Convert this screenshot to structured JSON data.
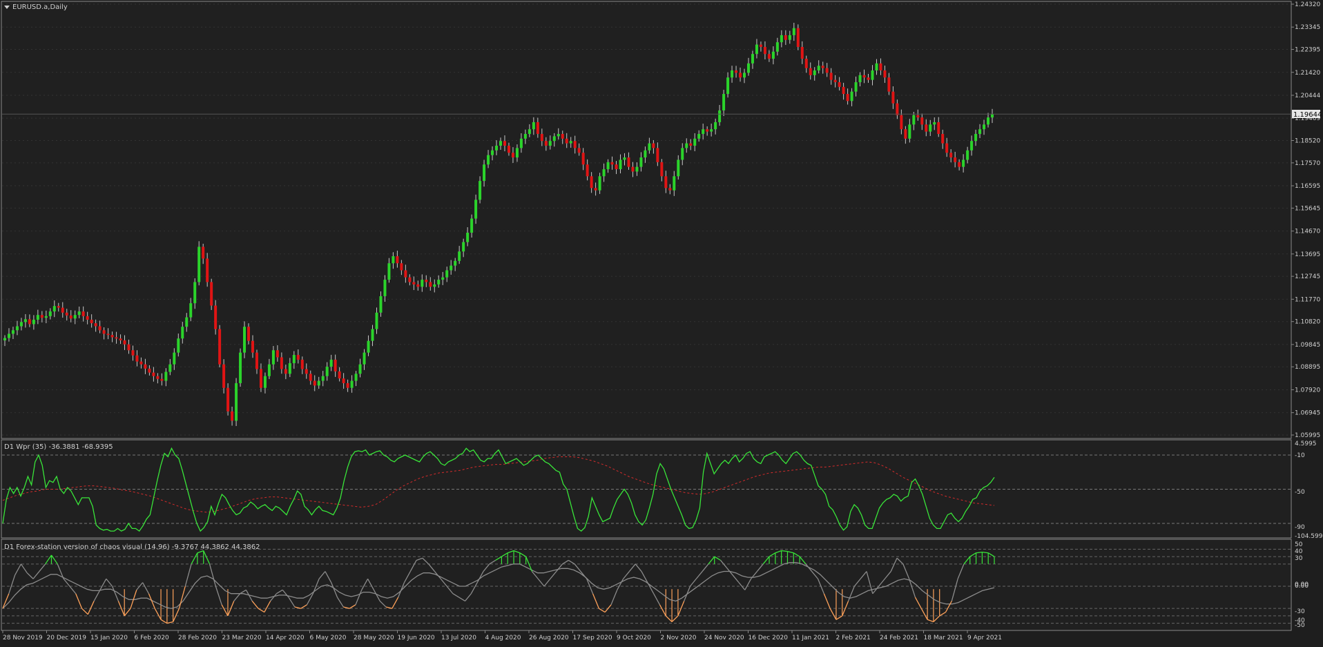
{
  "colors": {
    "background": "#1e1e1e",
    "chart_bg": "#202020",
    "grid": "#333333",
    "border": "#8a8a8a",
    "text": "#d0d0d0",
    "bull": "#2bd42b",
    "bear": "#e01414",
    "wick": "#c8c8c8",
    "wpr_line": "#39e639",
    "wpr_signal": "#d62b2b",
    "chaos_gray": "#8c8c8c",
    "chaos_green": "#39e639",
    "chaos_orange": "#ffa25a",
    "price_tag_bg": "#e8e8e8",
    "price_tag_text": "#000000"
  },
  "main": {
    "symbol_label": "EURUSD.a,Daily",
    "current_price": "1.19644"
  },
  "wpr": {
    "label": "D1 Wpr (35) -36.3881 -68.9395",
    "right_labels": [
      "4.5995",
      "-10",
      "-50",
      "-90",
      "-104.5996"
    ],
    "dashed_levels": [
      -10,
      -50,
      -90
    ]
  },
  "chaos": {
    "label": "D1 Forex-station version of chaos visual (14.96) -9.3767 44.3862 44.3862",
    "right_labels": [
      "50",
      "40",
      "30",
      "0.00",
      "0.00",
      "-30",
      "-40",
      "-50"
    ],
    "dashed_levels": [
      50,
      40,
      30,
      0,
      -30,
      -40,
      -50
    ]
  },
  "chart_data": [
    {
      "type": "candlestick",
      "title": "EURUSD.a,Daily",
      "ylim": [
        1.05995,
        1.2432
      ],
      "y_ticks": [
        "1.24320",
        "1.23345",
        "1.22395",
        "1.21420",
        "1.20444",
        "1.19469",
        "1.18520",
        "1.17570",
        "1.16595",
        "1.15645",
        "1.14670",
        "1.13695",
        "1.12745",
        "1.11770",
        "1.10820",
        "1.09845",
        "1.08895",
        "1.07920",
        "1.06945",
        "1.05995"
      ],
      "x_ticks": [
        "28 Nov 2019",
        "20 Dec 2019",
        "15 Jan 2020",
        "6 Feb 2020",
        "28 Feb 2020",
        "23 Mar 2020",
        "14 Apr 2020",
        "6 May 2020",
        "28 May 2020",
        "19 Jun 2020",
        "13 Jul 2020",
        "4 Aug 2020",
        "26 Aug 2020",
        "17 Sep 2020",
        "9 Oct 2020",
        "2 Nov 2020",
        "24 Nov 2020",
        "16 Dec 2020",
        "11 Jan 2021",
        "2 Feb 2021",
        "24 Feb 2021",
        "18 Mar 2021",
        "9 Apr 2021"
      ],
      "closes": [
        1.1012,
        1.103,
        1.1045,
        1.1062,
        1.108,
        1.1092,
        1.1071,
        1.109,
        1.111,
        1.1098,
        1.1105,
        1.1125,
        1.1148,
        1.1141,
        1.112,
        1.1108,
        1.1095,
        1.111,
        1.1125,
        1.1105,
        1.109,
        1.1075,
        1.1062,
        1.1045,
        1.103,
        1.1025,
        1.1015,
        1.101,
        1.1002,
        1.0985,
        1.096,
        1.0938,
        1.0912,
        1.09,
        1.0882,
        1.0865,
        1.085,
        1.0838,
        1.083,
        1.0868,
        1.09,
        1.095,
        1.101,
        1.106,
        1.11,
        1.116,
        1.125,
        1.14,
        1.135,
        1.125,
        1.115,
        1.105,
        1.09,
        1.08,
        1.07,
        1.066,
        1.082,
        1.095,
        1.106,
        1.1,
        1.095,
        1.088,
        1.08,
        1.085,
        1.09,
        1.096,
        1.093,
        1.088,
        1.086,
        1.0905,
        1.094,
        1.092,
        1.088,
        1.086,
        1.083,
        1.081,
        1.083,
        1.085,
        1.089,
        1.092,
        1.087,
        1.084,
        1.082,
        1.08,
        1.083,
        1.086,
        1.09,
        1.095,
        1.1,
        1.105,
        1.112,
        1.119,
        1.126,
        1.133,
        1.136,
        1.133,
        1.13,
        1.127,
        1.125,
        1.124,
        1.123,
        1.126,
        1.125,
        1.123,
        1.124,
        1.126,
        1.127,
        1.13,
        1.132,
        1.134,
        1.138,
        1.142,
        1.146,
        1.152,
        1.16,
        1.168,
        1.175,
        1.179,
        1.181,
        1.183,
        1.185,
        1.183,
        1.18,
        1.178,
        1.182,
        1.186,
        1.188,
        1.19,
        1.193,
        1.188,
        1.185,
        1.183,
        1.185,
        1.187,
        1.188,
        1.186,
        1.184,
        1.185,
        1.182,
        1.18,
        1.175,
        1.17,
        1.165,
        1.164,
        1.17,
        1.173,
        1.176,
        1.175,
        1.173,
        1.177,
        1.178,
        1.174,
        1.172,
        1.174,
        1.178,
        1.181,
        1.184,
        1.182,
        1.176,
        1.17,
        1.165,
        1.164,
        1.17,
        1.177,
        1.182,
        1.184,
        1.183,
        1.186,
        1.188,
        1.19,
        1.189,
        1.19,
        1.193,
        1.198,
        1.205,
        1.212,
        1.215,
        1.214,
        1.212,
        1.214,
        1.218,
        1.222,
        1.226,
        1.225,
        1.222,
        1.22,
        1.223,
        1.227,
        1.23,
        1.228,
        1.23,
        1.233,
        1.225,
        1.22,
        1.216,
        1.213,
        1.215,
        1.217,
        1.216,
        1.214,
        1.211,
        1.21,
        1.208,
        1.205,
        1.202,
        1.206,
        1.21,
        1.213,
        1.212,
        1.211,
        1.215,
        1.218,
        1.215,
        1.212,
        1.206,
        1.201,
        1.196,
        1.19,
        1.186,
        1.192,
        1.196,
        1.195,
        1.192,
        1.189,
        1.192,
        1.193,
        1.188,
        1.184,
        1.18,
        1.178,
        1.176,
        1.174,
        1.177,
        1.181,
        1.185,
        1.188,
        1.19,
        1.192,
        1.195,
        1.1964
      ],
      "current_price": 1.19644
    },
    {
      "type": "line",
      "title": "D1 Wpr (35) -36.3881 -68.9395",
      "ylim": [
        -104.5996,
        4.5995
      ],
      "series": [
        {
          "values": [
            -90,
            -62,
            -48,
            -55,
            -48,
            -58,
            -48,
            -35,
            -45,
            -18,
            -10,
            -22,
            -48,
            -40,
            -42,
            -35,
            -50,
            -55,
            -48,
            -52,
            -60,
            -68,
            -60,
            -60,
            -60,
            -70,
            -92,
            -96,
            -98,
            -97,
            -99,
            -99,
            -96,
            -99,
            -97,
            -90,
            -96,
            -96,
            -99,
            -93,
            -85,
            -80,
            -60,
            -40,
            -22,
            -8,
            -12,
            -2,
            -10,
            -14,
            -28,
            -44,
            -60,
            -76,
            -90,
            -99,
            -95,
            -88,
            -70,
            -80,
            -67,
            -56,
            -60,
            -68,
            -75,
            -80,
            -78,
            -72,
            -70,
            -65,
            -68,
            -73,
            -70,
            -68,
            -72,
            -75,
            -70,
            -72,
            -76,
            -80,
            -70,
            -62,
            -52,
            -56,
            -70,
            -74,
            -80,
            -74,
            -70,
            -75,
            -76,
            -78,
            -80,
            -72,
            -60,
            -40,
            -24,
            -12,
            -6,
            -5,
            -6,
            -4,
            -10,
            -8,
            -6,
            -5,
            -10,
            -12,
            -16,
            -18,
            -14,
            -12,
            -10,
            -12,
            -14,
            -16,
            -18,
            -12,
            -8,
            -6,
            -10,
            -14,
            -20,
            -22,
            -18,
            -16,
            -14,
            -10,
            -8,
            -2,
            -6,
            -4,
            -10,
            -16,
            -18,
            -14,
            -14,
            -8,
            -4,
            -12,
            -20,
            -18,
            -16,
            -14,
            -18,
            -22,
            -20,
            -16,
            -12,
            -10,
            -14,
            -18,
            -20,
            -24,
            -28,
            -30,
            -44,
            -50,
            -66,
            -82,
            -96,
            -99,
            -95,
            -82,
            -60,
            -70,
            -80,
            -88,
            -86,
            -84,
            -72,
            -62,
            -56,
            -50,
            -56,
            -66,
            -80,
            -88,
            -92,
            -86,
            -72,
            -56,
            -32,
            -20,
            -26,
            -38,
            -50,
            -60,
            -70,
            -80,
            -92,
            -96,
            -95,
            -86,
            -72,
            -30,
            -8,
            -20,
            -32,
            -26,
            -20,
            -16,
            -20,
            -14,
            -10,
            -18,
            -14,
            -8,
            -6,
            -14,
            -18,
            -20,
            -12,
            -10,
            -8,
            -6,
            -10,
            -16,
            -20,
            -14,
            -8,
            -6,
            -10,
            -16,
            -20,
            -22,
            -34,
            -46,
            -50,
            -56,
            -70,
            -74,
            -82,
            -92,
            -98,
            -94,
            -76,
            -68,
            -72,
            -80,
            -92,
            -96,
            -96,
            -84,
            -72,
            -66,
            -62,
            -60,
            -56,
            -58,
            -64,
            -60,
            -58,
            -42,
            -38,
            -46,
            -56,
            -70,
            -84,
            -92,
            -96,
            -96,
            -88,
            -80,
            -78,
            -84,
            -88,
            -84,
            -76,
            -70,
            -62,
            -60,
            -52,
            -48,
            -46,
            -42,
            -36
          ]
        },
        {
          "values": [
            -63,
            -60,
            -57,
            -55,
            -53,
            -52,
            -50,
            -50,
            -50,
            -49,
            -48,
            -47,
            -46,
            -46,
            -47,
            -48,
            -49,
            -51,
            -52,
            -54,
            -56,
            -58,
            -61,
            -64,
            -67,
            -70,
            -73,
            -75,
            -76,
            -77,
            -76,
            -74,
            -72,
            -69,
            -66,
            -63,
            -61,
            -60,
            -59,
            -59,
            -60,
            -61,
            -62,
            -63,
            -64,
            -65,
            -66,
            -67,
            -68,
            -69,
            -70,
            -71,
            -70,
            -68,
            -63,
            -57,
            -51,
            -46,
            -42,
            -38,
            -35,
            -33,
            -31,
            -30,
            -29,
            -28,
            -26,
            -24,
            -23,
            -22,
            -21,
            -21,
            -20,
            -19,
            -18,
            -17,
            -16,
            -14,
            -13,
            -12,
            -12,
            -12,
            -13,
            -15,
            -17,
            -20,
            -23,
            -27,
            -31,
            -35,
            -38,
            -41,
            -44,
            -46,
            -48,
            -50,
            -52,
            -54,
            -55,
            -56,
            -55,
            -53,
            -50,
            -47,
            -44,
            -41,
            -38,
            -35,
            -33,
            -31,
            -30,
            -29,
            -28,
            -27,
            -26,
            -25,
            -24,
            -24,
            -23,
            -22,
            -21,
            -20,
            -19,
            -18,
            -19,
            -22,
            -26,
            -31,
            -36,
            -40,
            -44,
            -48,
            -52,
            -55,
            -58,
            -60,
            -62,
            -64,
            -66,
            -67,
            -68,
            -69
          ]
        }
      ],
      "levels": [
        -10,
        -50,
        -90
      ]
    },
    {
      "type": "line",
      "title": "D1 Forex-station version of chaos visual (14.96) -9.3767 44.3862 44.3862",
      "ylim": [
        -55,
        55
      ],
      "series": [
        {
          "values": [
            -30,
            -10,
            15,
            30,
            18,
            10,
            20,
            30,
            42,
            30,
            10,
            0,
            -10,
            -30,
            -38,
            -20,
            -5,
            10,
            0,
            -20,
            -40,
            -30,
            -5,
            5,
            -10,
            -30,
            -45,
            -50,
            -48,
            -30,
            0,
            30,
            45,
            48,
            30,
            0,
            -25,
            -40,
            -20,
            -10,
            -5,
            -20,
            -30,
            -35,
            -20,
            -10,
            -5,
            -15,
            -28,
            -30,
            -25,
            -10,
            10,
            20,
            5,
            -15,
            -28,
            -30,
            -25,
            -5,
            10,
            -5,
            -20,
            -28,
            -30,
            -15,
            5,
            20,
            35,
            38,
            30,
            20,
            10,
            0,
            -10,
            -15,
            -20,
            -10,
            5,
            20,
            30,
            35,
            40,
            45,
            48,
            45,
            40,
            20,
            10,
            0,
            10,
            20,
            30,
            35,
            30,
            20,
            10,
            -10,
            -30,
            -35,
            -25,
            -5,
            10,
            20,
            30,
            20,
            5,
            -10,
            -25,
            -40,
            -48,
            -40,
            -20,
            0,
            10,
            20,
            30,
            40,
            35,
            25,
            15,
            5,
            -5,
            10,
            20,
            30,
            40,
            45,
            48,
            47,
            45,
            40,
            30,
            20,
            10,
            -10,
            -30,
            -45,
            -40,
            -20,
            0,
            10,
            20,
            -10,
            0,
            10,
            20,
            38,
            30,
            10,
            -15,
            -30,
            -45,
            -48,
            -40,
            -35,
            -20,
            10,
            30,
            40,
            45,
            46,
            45,
            40
          ]
        },
        {
          "values": [
            -30,
            -22,
            -12,
            -4,
            2,
            4,
            8,
            12,
            16,
            16,
            12,
            8,
            4,
            0,
            -4,
            -6,
            -6,
            -4,
            -4,
            -8,
            -14,
            -18,
            -18,
            -16,
            -16,
            -20,
            -24,
            -28,
            -30,
            -28,
            -20,
            -8,
            4,
            12,
            14,
            10,
            2,
            -6,
            -10,
            -10,
            -10,
            -12,
            -14,
            -16,
            -16,
            -14,
            -12,
            -12,
            -14,
            -16,
            -16,
            -12,
            -6,
            0,
            2,
            -2,
            -8,
            -12,
            -14,
            -12,
            -8,
            -8,
            -10,
            -14,
            -16,
            -14,
            -8,
            0,
            8,
            14,
            18,
            18,
            16,
            12,
            8,
            4,
            0,
            0,
            4,
            8,
            14,
            18,
            22,
            26,
            28,
            30,
            30,
            26,
            22,
            18,
            18,
            20,
            22,
            24,
            24,
            22,
            18,
            12,
            4,
            -2,
            -4,
            -2,
            2,
            6,
            10,
            12,
            10,
            6,
            0,
            -6,
            -12,
            -18,
            -20,
            -16,
            -10,
            -4,
            2,
            8,
            14,
            18,
            20,
            20,
            18,
            14,
            12,
            12,
            14,
            18,
            22,
            26,
            30,
            32,
            32,
            30,
            26,
            22,
            16,
            8,
            0,
            -8,
            -14,
            -16,
            -14,
            -10,
            -6,
            -4,
            -2,
            0,
            4,
            8,
            10,
            8,
            2,
            -6,
            -12,
            -18,
            -22,
            -24,
            -24,
            -22,
            -18,
            -14,
            -10,
            -6,
            -4,
            -2
          ]
        }
      ],
      "levels": [
        50,
        40,
        30,
        0,
        -30,
        -40,
        -50
      ]
    }
  ]
}
